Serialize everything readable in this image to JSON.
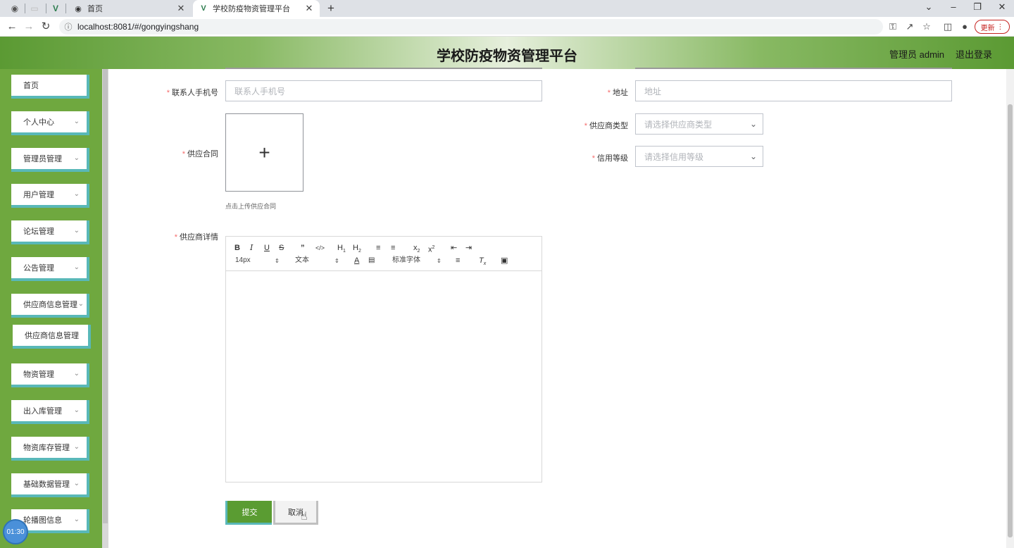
{
  "browser": {
    "tabs": [
      {
        "favicon": "globe-icon",
        "title": "首页"
      },
      {
        "favicon": "vue-icon",
        "title": "学校防疫物资管理平台"
      }
    ],
    "url": "localhost:8081/#/gongyingshang",
    "update_label": "更新"
  },
  "header": {
    "title": "学校防疫物资管理平台",
    "user": "管理员 admin",
    "logout": "退出登录"
  },
  "sidebar": {
    "items": [
      {
        "label": "首页"
      },
      {
        "label": "个人中心"
      },
      {
        "label": "管理员管理"
      },
      {
        "label": "用户管理"
      },
      {
        "label": "论坛管理"
      },
      {
        "label": "公告管理"
      },
      {
        "label": "供应商信息管理"
      },
      {
        "label": "供应商信息管理"
      },
      {
        "label": "物资管理"
      },
      {
        "label": "出入库管理"
      },
      {
        "label": "物资库存管理"
      },
      {
        "label": "基础数据管理"
      },
      {
        "label": "轮播图信息"
      }
    ],
    "timer": "01:30"
  },
  "form": {
    "phone": {
      "label": "联系人手机号",
      "placeholder": "联系人手机号"
    },
    "address": {
      "label": "地址",
      "placeholder": "地址"
    },
    "contract": {
      "label": "供应合同",
      "tip": "点击上传供应合同"
    },
    "supplier_type": {
      "label": "供应商类型",
      "placeholder": "请选择供应商类型"
    },
    "credit_level": {
      "label": "信用等级",
      "placeholder": "请选择信用等级"
    },
    "details": {
      "label": "供应商详情"
    },
    "required_mark": "*"
  },
  "editor": {
    "font_size": "14px",
    "block_format": "文本",
    "font_family": "标准字体"
  },
  "actions": {
    "submit": "提交",
    "cancel": "取消"
  },
  "colors": {
    "sidebar_bg": "#6fa83f",
    "accent_border": "#59b8b8",
    "submit_bg": "#5a9c32",
    "required": "#f56c6c"
  }
}
